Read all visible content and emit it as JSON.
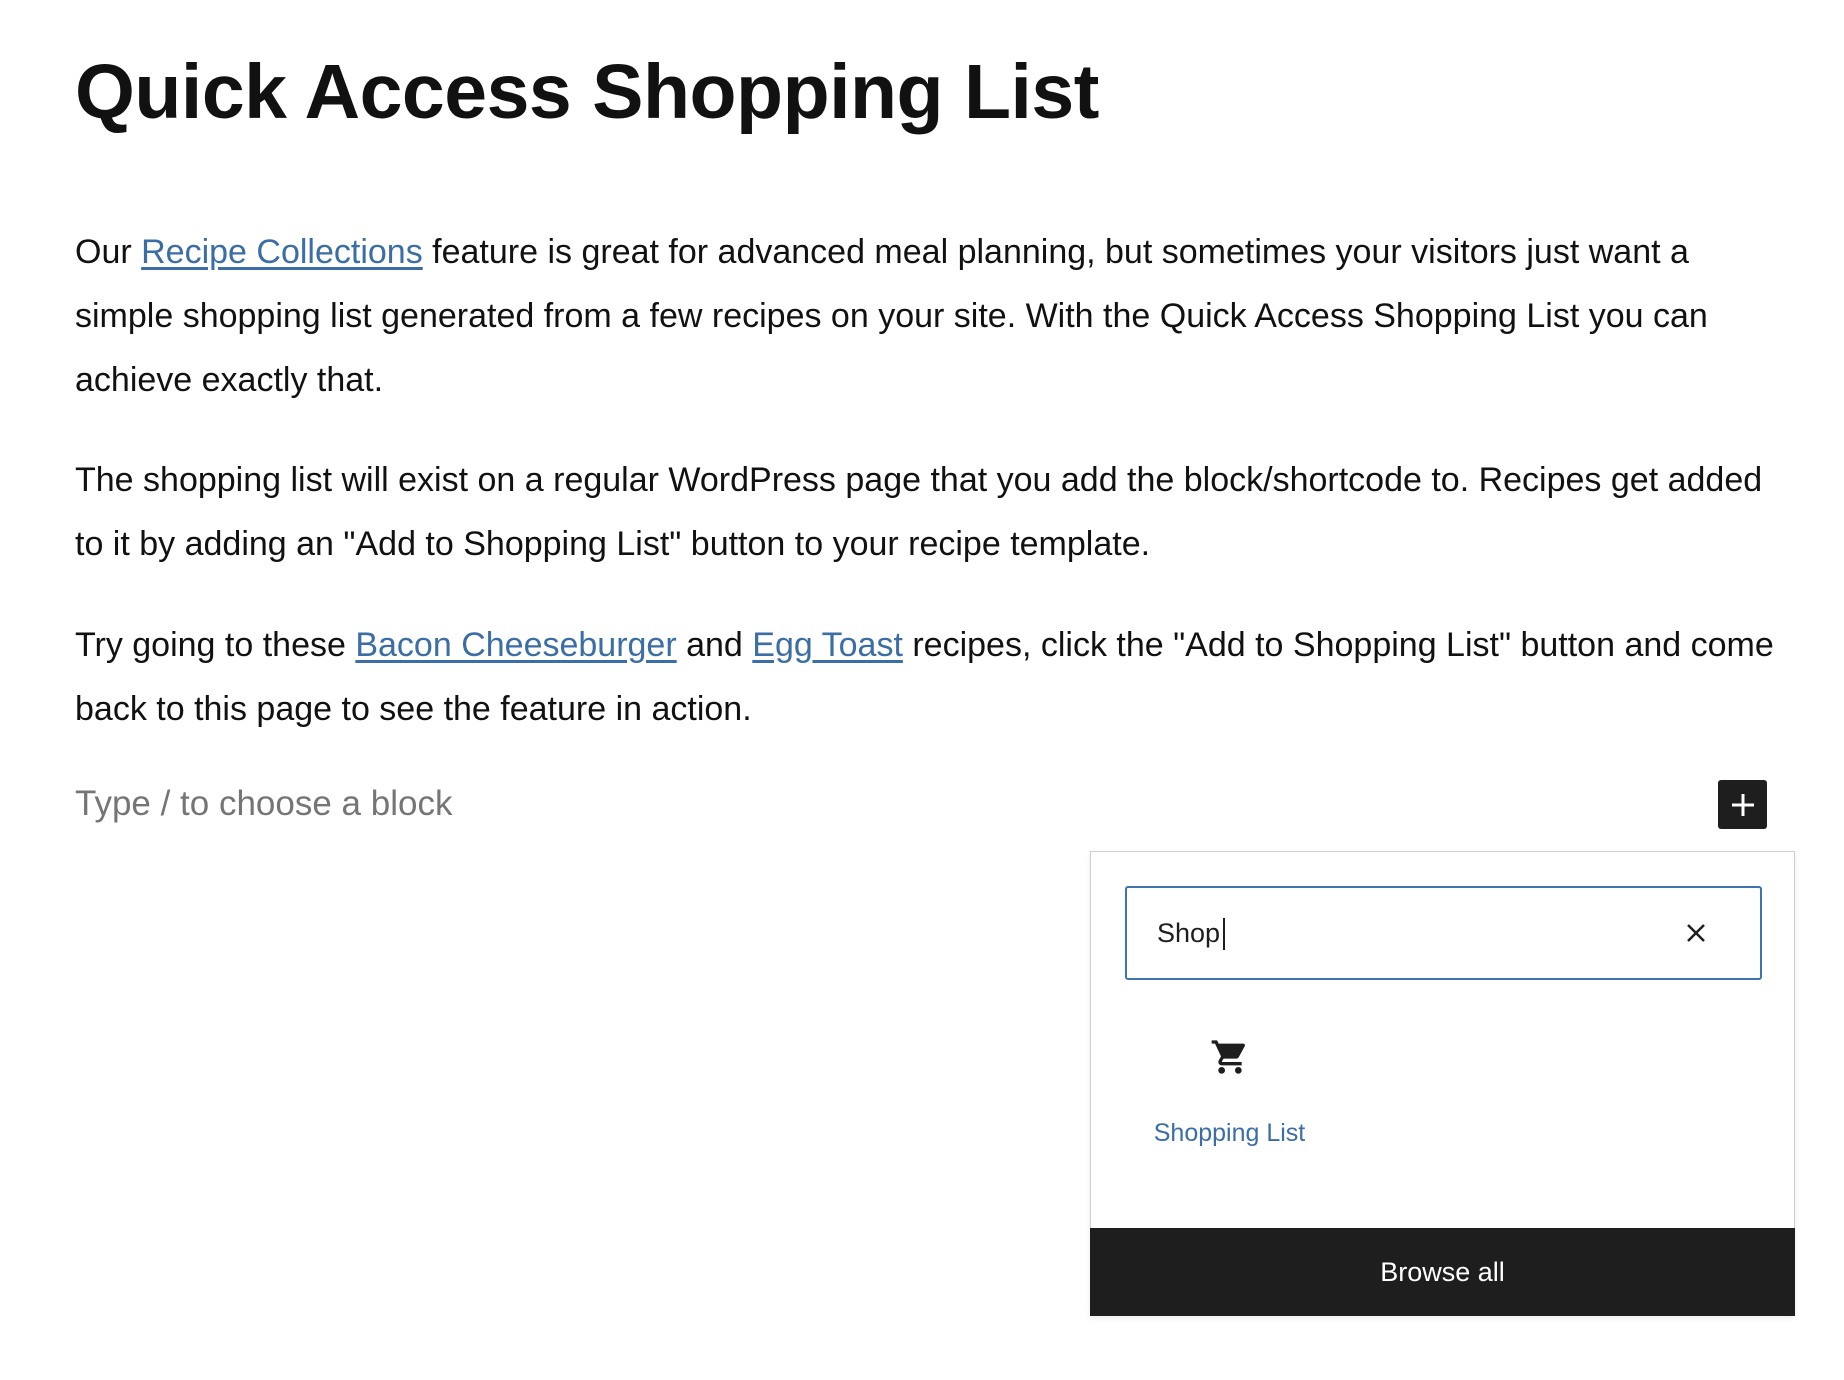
{
  "page": {
    "title": "Quick Access Shopping List"
  },
  "paragraphs": {
    "p1": {
      "before": "Our ",
      "link": "Recipe Collections",
      "after": " feature is great for advanced meal planning, but sometimes your visitors just want a simple shopping list generated from a few recipes on your site. With the Quick Access Shopping List you can achieve exactly that."
    },
    "p2": {
      "text": "The shopping list will exist on a regular WordPress page that you add the block/shortcode to. Recipes get added to it by adding an \"Add to Shopping List\" button to your recipe template."
    },
    "p3": {
      "before": "Try going to these ",
      "link1": "Bacon Cheeseburger",
      "middle": " and ",
      "link2": "Egg Toast",
      "after": " recipes, click the \"Add to Shopping List\" button and come back to this page to see the feature in action."
    }
  },
  "editor": {
    "block_placeholder": "Type / to choose a block",
    "inserter_icon": "plus-icon"
  },
  "inserter": {
    "search_value": "Shop",
    "clear_icon": "close-icon",
    "results": [
      {
        "label": "Shopping List",
        "icon": "cart-icon"
      }
    ],
    "browse_all_label": "Browse all"
  },
  "colors": {
    "link": "#3a6ea5",
    "focus_border": "#3f74ae",
    "dark": "#1e1e1e",
    "placeholder": "#757575"
  }
}
